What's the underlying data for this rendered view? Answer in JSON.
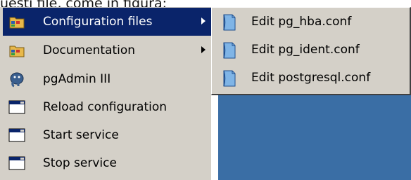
{
  "background_caption": "uesti file, come in figura:",
  "menu": {
    "items": [
      {
        "label": "Configuration files",
        "icon": "program-group-folder-icon",
        "has_submenu": true,
        "selected": true
      },
      {
        "label": "Documentation",
        "icon": "program-group-folder-icon",
        "has_submenu": true,
        "selected": false
      },
      {
        "label": "pgAdmin III",
        "icon": "elephant-icon",
        "has_submenu": false,
        "selected": false
      },
      {
        "label": "Reload configuration",
        "icon": "window-shortcut-icon",
        "has_submenu": false,
        "selected": false
      },
      {
        "label": "Start service",
        "icon": "window-shortcut-icon",
        "has_submenu": false,
        "selected": false
      },
      {
        "label": "Stop service",
        "icon": "window-shortcut-icon",
        "has_submenu": false,
        "selected": false
      }
    ]
  },
  "submenu": {
    "items": [
      {
        "label": "Edit pg_hba.conf",
        "icon": "document-file-icon"
      },
      {
        "label": "Edit pg_ident.conf",
        "icon": "document-file-icon"
      },
      {
        "label": "Edit postgresql.conf",
        "icon": "document-file-icon"
      }
    ]
  },
  "colors": {
    "menu_bg": "#d4d0c8",
    "selection": "#0a246a",
    "desktop": "#3a6ea5"
  }
}
